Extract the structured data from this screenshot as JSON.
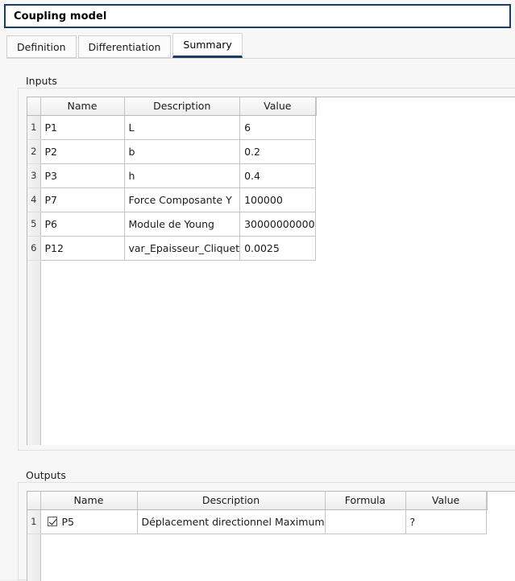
{
  "window": {
    "title": "Coupling model"
  },
  "tabs": [
    {
      "label": "Definition",
      "selected": false
    },
    {
      "label": "Differentiation",
      "selected": false
    },
    {
      "label": "Summary",
      "selected": true
    }
  ],
  "inputs": {
    "group_label": "Inputs",
    "columns": [
      "Name",
      "Description",
      "Value"
    ],
    "rows": [
      {
        "num": "1",
        "name": "P1",
        "description": "L",
        "value": "6"
      },
      {
        "num": "2",
        "name": "P2",
        "description": "b",
        "value": "0.2"
      },
      {
        "num": "3",
        "name": "P3",
        "description": "h",
        "value": "0.4"
      },
      {
        "num": "4",
        "name": "P7",
        "description": "Force Composante Y",
        "value": "100000"
      },
      {
        "num": "5",
        "name": "P6",
        "description": "Module de Young",
        "value": "30000000000"
      },
      {
        "num": "6",
        "name": "P12",
        "description": "var_Epaisseur_Cliquet",
        "value": "0.0025"
      }
    ]
  },
  "outputs": {
    "group_label": "Outputs",
    "columns": [
      "Name",
      "Description",
      "Formula",
      "Value"
    ],
    "rows": [
      {
        "num": "1",
        "checked": true,
        "name": "P5",
        "description": "Déplacement directionnel Maximum",
        "formula": "",
        "value": "?"
      }
    ]
  },
  "colors": {
    "title_border": "#1b3c63",
    "tab_accent": "#1b3c63",
    "grid_line": "#c4c4c4",
    "panel_bg": "#f7f7f7"
  }
}
